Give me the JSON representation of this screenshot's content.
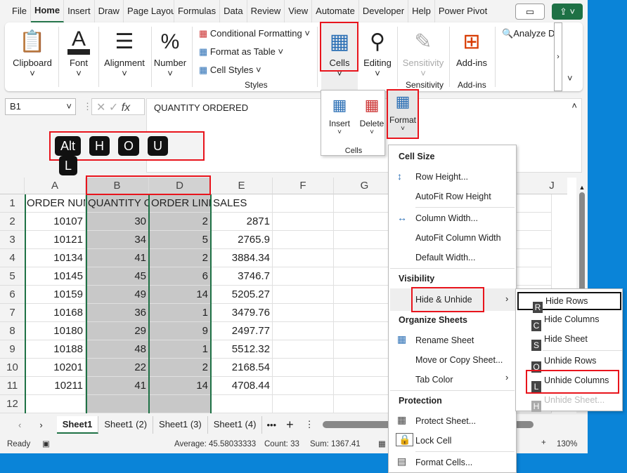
{
  "tabs": [
    "File",
    "Home",
    "Insert",
    "Draw",
    "Page Layout",
    "Formulas",
    "Data",
    "Review",
    "View",
    "Automate",
    "Developer",
    "Help",
    "Power Pivot"
  ],
  "ribbon": {
    "clipboard": "Clipboard",
    "font": "Font",
    "alignment": "Alignment",
    "number": "Number",
    "conditional": "Conditional Formatting",
    "format_table": "Format as Table",
    "cell_styles": "Cell Styles",
    "styles": "Styles",
    "cells": "Cells",
    "editing": "Editing",
    "sensitivity": "Sensitivity",
    "sensitivity_group": "Sensitivity",
    "addins": "Add-ins",
    "addins_group": "Add-ins",
    "analyze": "Analyze Data"
  },
  "cells_panel": {
    "insert": "Insert",
    "delete": "Delete",
    "format": "Format",
    "group": "Cells"
  },
  "name_box": "B1",
  "fx": "fx",
  "formula": "QUANTITY ORDERED",
  "keytips": [
    "Alt",
    "H",
    "O",
    "U",
    "L"
  ],
  "columns": [
    "A",
    "B",
    "D",
    "E",
    "F",
    "G",
    "J"
  ],
  "rows": [
    "1",
    "2",
    "3",
    "4",
    "5",
    "6",
    "7",
    "8",
    "9",
    "10",
    "11",
    "12"
  ],
  "table": [
    [
      "ORDER NUMBER",
      "QUANTITY ORDERED",
      "ORDER LINE NUMBER",
      "SALES"
    ],
    [
      "10107",
      "30",
      "2",
      "2871"
    ],
    [
      "10121",
      "34",
      "5",
      "2765.9"
    ],
    [
      "10134",
      "41",
      "2",
      "3884.34"
    ],
    [
      "10145",
      "45",
      "6",
      "3746.7"
    ],
    [
      "10159",
      "49",
      "14",
      "5205.27"
    ],
    [
      "10168",
      "36",
      "1",
      "3479.76"
    ],
    [
      "10180",
      "29",
      "9",
      "2497.77"
    ],
    [
      "10188",
      "48",
      "1",
      "5512.32"
    ],
    [
      "10201",
      "22",
      "2",
      "2168.54"
    ],
    [
      "10211",
      "41",
      "14",
      "4708.44"
    ]
  ],
  "format_menu": {
    "cell_size": "Cell Size",
    "row_height": "Row Height...",
    "autofit_row": "AutoFit Row Height",
    "col_width": "Column Width...",
    "autofit_col": "AutoFit Column Width",
    "default_width": "Default Width...",
    "visibility": "Visibility",
    "hide_unhide": "Hide & Unhide",
    "organize": "Organize Sheets",
    "rename": "Rename Sheet",
    "move_copy": "Move or Copy Sheet...",
    "tab_color": "Tab Color",
    "protection": "Protection",
    "protect": "Protect Sheet...",
    "lock": "Lock Cell",
    "format_cells": "Format Cells..."
  },
  "submenu": [
    {
      "key": "R",
      "label": "Hide Rows"
    },
    {
      "key": "C",
      "label": "Hide Columns"
    },
    {
      "key": "S",
      "label": "Hide Sheet"
    },
    {
      "key": "O",
      "label": "Unhide Rows"
    },
    {
      "key": "L",
      "label": "Unhide Columns"
    },
    {
      "key": "H",
      "label": "Unhide Sheet...",
      "disabled": true
    }
  ],
  "sheets": [
    "Sheet1",
    "Sheet1 (2)",
    "Sheet1 (3)",
    "Sheet1 (4)"
  ],
  "status": {
    "ready": "Ready",
    "average": "Average: 45.58033333",
    "count": "Count: 33",
    "sum": "Sum: 1367.41",
    "zoom": "130%"
  },
  "colors": {
    "accent": "#1e7145",
    "highlight": "#e8141c",
    "selection": "#c8c8c8",
    "desktop": "#0a84d8"
  }
}
